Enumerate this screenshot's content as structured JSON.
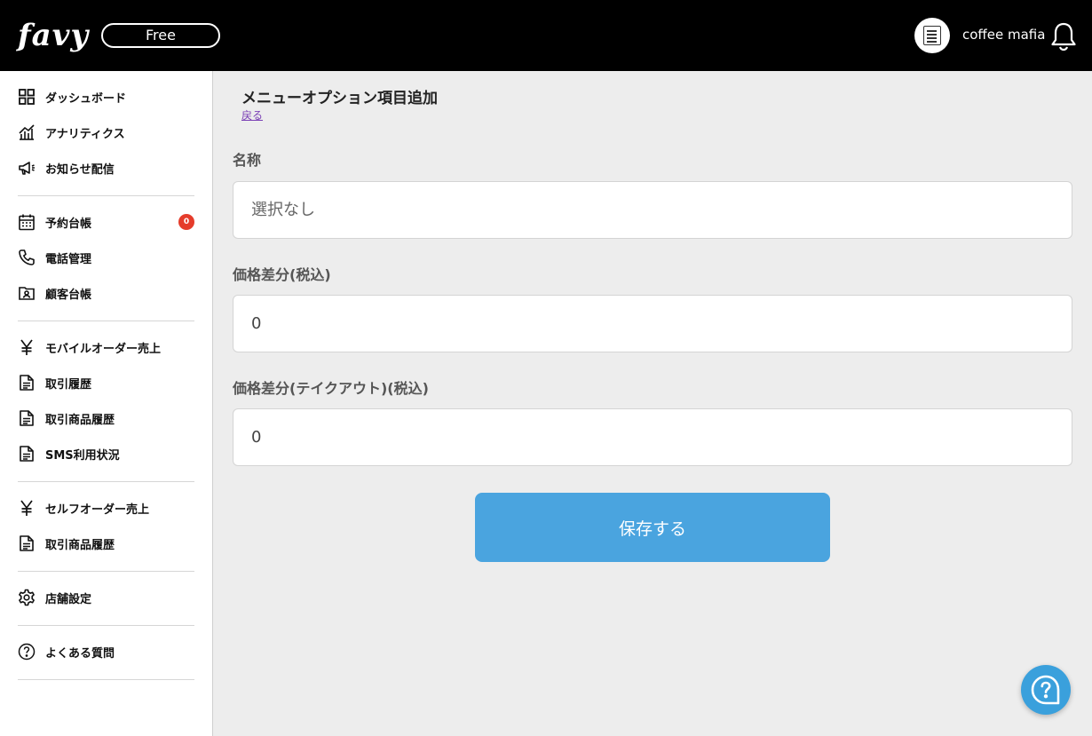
{
  "header": {
    "logo_text": "favy",
    "plan_label": "Free",
    "account_name": "coffee mafia",
    "avatar_icon": "coffee-mafia-logo-icon",
    "bell_icon": "bell-icon",
    "background_color": "#000000"
  },
  "sidebar": {
    "items": [
      {
        "label": "ダッシュボード",
        "icon": "dashboard-grid-icon"
      },
      {
        "label": "アナリティクス",
        "icon": "analytics-chart-icon"
      },
      {
        "label": "お知らせ配信",
        "icon": "megaphone-icon"
      },
      {
        "label": "予約台帳",
        "icon": "calendar-icon",
        "badge": "0"
      },
      {
        "label": "電話管理",
        "icon": "phone-icon"
      },
      {
        "label": "顧客台帳",
        "icon": "contact-card-icon"
      },
      {
        "label": "モバイルオーダー売上",
        "icon": "yen-icon"
      },
      {
        "label": "取引履歴",
        "icon": "document-icon"
      },
      {
        "label": "取引商品履歴",
        "icon": "document-icon"
      },
      {
        "label": "SMS利用状況",
        "icon": "document-icon"
      },
      {
        "label": "セルフオーダー売上",
        "icon": "yen-icon"
      },
      {
        "label": "取引商品履歴",
        "icon": "document-icon"
      },
      {
        "label": "店舗設定",
        "icon": "gear-icon"
      },
      {
        "label": "よくある質問",
        "icon": "question-circle-icon"
      }
    ],
    "badge_color": "#e53c2b"
  },
  "main": {
    "title": "メニューオプション項目追加",
    "back_label": "戻る",
    "fields": {
      "name": {
        "label": "名称",
        "placeholder": "選択なし",
        "value": ""
      },
      "price_diff": {
        "label": "価格差分(税込)",
        "value": "0"
      },
      "price_diff_takeout": {
        "label": "価格差分(テイクアウト)(税込)",
        "value": "0"
      }
    },
    "save_label": "保存する",
    "save_color": "#4aa4df"
  },
  "help": {
    "icon": "help-chat-icon",
    "color": "#3aa0dc"
  }
}
